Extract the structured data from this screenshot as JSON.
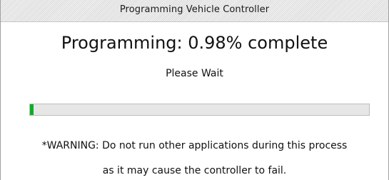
{
  "window": {
    "title": "Programming Vehicle Controller"
  },
  "main": {
    "heading": "Programming: 0.98% complete",
    "subheading": "Please Wait",
    "progress": {
      "percent": 0.98,
      "fill_color": "#06b025",
      "track_color": "#e6e6e6"
    },
    "warning_line_1": "*WARNING: Do not run other applications during this process",
    "warning_line_2": "as it may cause the controller to fail."
  }
}
